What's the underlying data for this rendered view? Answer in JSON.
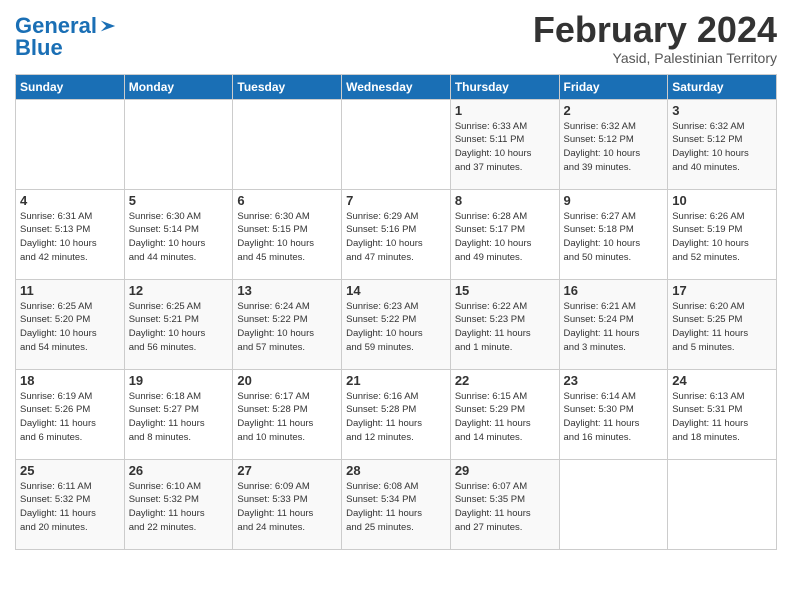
{
  "header": {
    "logo_general": "General",
    "logo_blue": "Blue",
    "month_title": "February 2024",
    "subtitle": "Yasid, Palestinian Territory"
  },
  "days_of_week": [
    "Sunday",
    "Monday",
    "Tuesday",
    "Wednesday",
    "Thursday",
    "Friday",
    "Saturday"
  ],
  "weeks": [
    [
      {
        "day": "",
        "info": ""
      },
      {
        "day": "",
        "info": ""
      },
      {
        "day": "",
        "info": ""
      },
      {
        "day": "",
        "info": ""
      },
      {
        "day": "1",
        "info": "Sunrise: 6:33 AM\nSunset: 5:11 PM\nDaylight: 10 hours\nand 37 minutes."
      },
      {
        "day": "2",
        "info": "Sunrise: 6:32 AM\nSunset: 5:12 PM\nDaylight: 10 hours\nand 39 minutes."
      },
      {
        "day": "3",
        "info": "Sunrise: 6:32 AM\nSunset: 5:12 PM\nDaylight: 10 hours\nand 40 minutes."
      }
    ],
    [
      {
        "day": "4",
        "info": "Sunrise: 6:31 AM\nSunset: 5:13 PM\nDaylight: 10 hours\nand 42 minutes."
      },
      {
        "day": "5",
        "info": "Sunrise: 6:30 AM\nSunset: 5:14 PM\nDaylight: 10 hours\nand 44 minutes."
      },
      {
        "day": "6",
        "info": "Sunrise: 6:30 AM\nSunset: 5:15 PM\nDaylight: 10 hours\nand 45 minutes."
      },
      {
        "day": "7",
        "info": "Sunrise: 6:29 AM\nSunset: 5:16 PM\nDaylight: 10 hours\nand 47 minutes."
      },
      {
        "day": "8",
        "info": "Sunrise: 6:28 AM\nSunset: 5:17 PM\nDaylight: 10 hours\nand 49 minutes."
      },
      {
        "day": "9",
        "info": "Sunrise: 6:27 AM\nSunset: 5:18 PM\nDaylight: 10 hours\nand 50 minutes."
      },
      {
        "day": "10",
        "info": "Sunrise: 6:26 AM\nSunset: 5:19 PM\nDaylight: 10 hours\nand 52 minutes."
      }
    ],
    [
      {
        "day": "11",
        "info": "Sunrise: 6:25 AM\nSunset: 5:20 PM\nDaylight: 10 hours\nand 54 minutes."
      },
      {
        "day": "12",
        "info": "Sunrise: 6:25 AM\nSunset: 5:21 PM\nDaylight: 10 hours\nand 56 minutes."
      },
      {
        "day": "13",
        "info": "Sunrise: 6:24 AM\nSunset: 5:22 PM\nDaylight: 10 hours\nand 57 minutes."
      },
      {
        "day": "14",
        "info": "Sunrise: 6:23 AM\nSunset: 5:22 PM\nDaylight: 10 hours\nand 59 minutes."
      },
      {
        "day": "15",
        "info": "Sunrise: 6:22 AM\nSunset: 5:23 PM\nDaylight: 11 hours\nand 1 minute."
      },
      {
        "day": "16",
        "info": "Sunrise: 6:21 AM\nSunset: 5:24 PM\nDaylight: 11 hours\nand 3 minutes."
      },
      {
        "day": "17",
        "info": "Sunrise: 6:20 AM\nSunset: 5:25 PM\nDaylight: 11 hours\nand 5 minutes."
      }
    ],
    [
      {
        "day": "18",
        "info": "Sunrise: 6:19 AM\nSunset: 5:26 PM\nDaylight: 11 hours\nand 6 minutes."
      },
      {
        "day": "19",
        "info": "Sunrise: 6:18 AM\nSunset: 5:27 PM\nDaylight: 11 hours\nand 8 minutes."
      },
      {
        "day": "20",
        "info": "Sunrise: 6:17 AM\nSunset: 5:28 PM\nDaylight: 11 hours\nand 10 minutes."
      },
      {
        "day": "21",
        "info": "Sunrise: 6:16 AM\nSunset: 5:28 PM\nDaylight: 11 hours\nand 12 minutes."
      },
      {
        "day": "22",
        "info": "Sunrise: 6:15 AM\nSunset: 5:29 PM\nDaylight: 11 hours\nand 14 minutes."
      },
      {
        "day": "23",
        "info": "Sunrise: 6:14 AM\nSunset: 5:30 PM\nDaylight: 11 hours\nand 16 minutes."
      },
      {
        "day": "24",
        "info": "Sunrise: 6:13 AM\nSunset: 5:31 PM\nDaylight: 11 hours\nand 18 minutes."
      }
    ],
    [
      {
        "day": "25",
        "info": "Sunrise: 6:11 AM\nSunset: 5:32 PM\nDaylight: 11 hours\nand 20 minutes."
      },
      {
        "day": "26",
        "info": "Sunrise: 6:10 AM\nSunset: 5:32 PM\nDaylight: 11 hours\nand 22 minutes."
      },
      {
        "day": "27",
        "info": "Sunrise: 6:09 AM\nSunset: 5:33 PM\nDaylight: 11 hours\nand 24 minutes."
      },
      {
        "day": "28",
        "info": "Sunrise: 6:08 AM\nSunset: 5:34 PM\nDaylight: 11 hours\nand 25 minutes."
      },
      {
        "day": "29",
        "info": "Sunrise: 6:07 AM\nSunset: 5:35 PM\nDaylight: 11 hours\nand 27 minutes."
      },
      {
        "day": "",
        "info": ""
      },
      {
        "day": "",
        "info": ""
      }
    ]
  ]
}
